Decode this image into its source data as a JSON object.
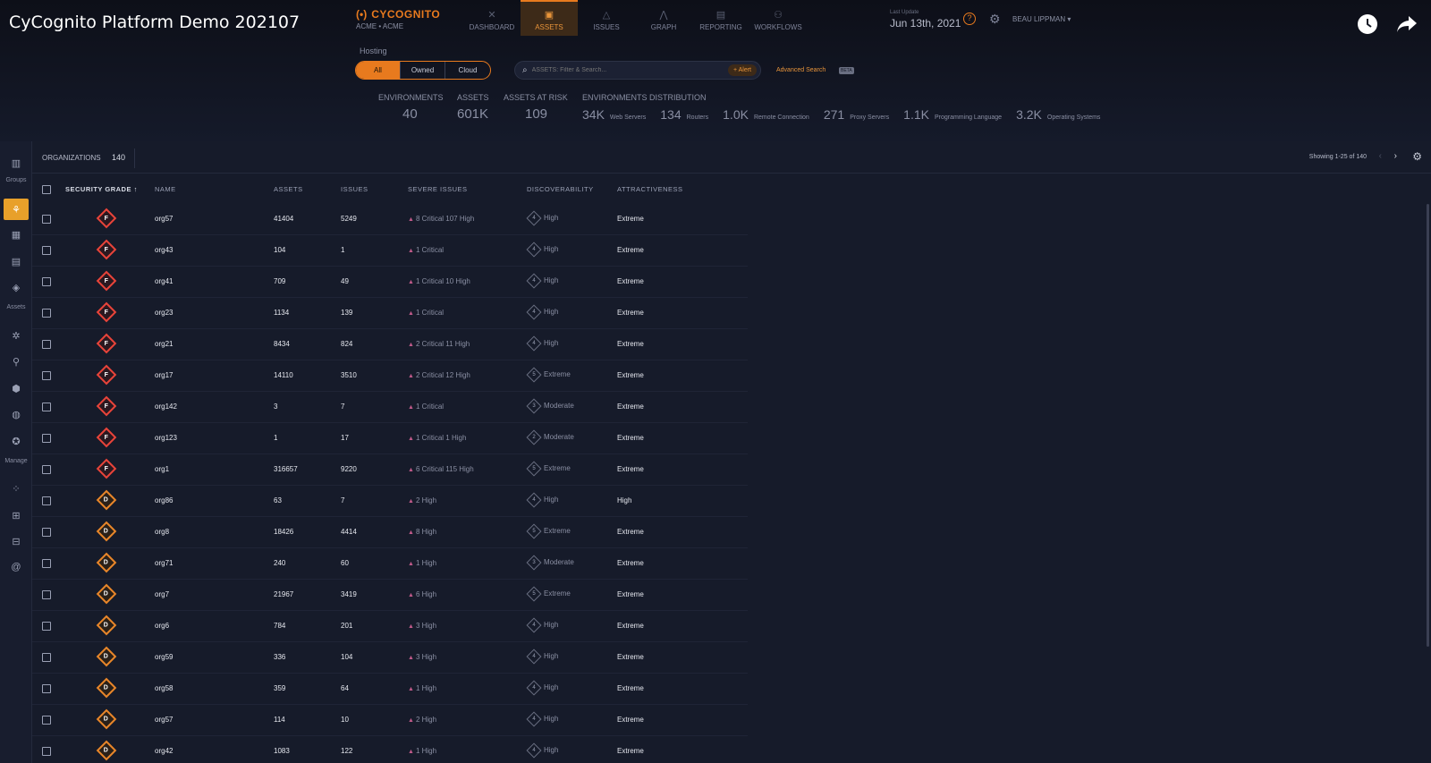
{
  "video": {
    "title": "CyCognito Platform Demo 202107"
  },
  "brand": {
    "name": "CYCOGNITO",
    "org_selector": "ACME • ACME"
  },
  "nav": {
    "items": [
      {
        "label": "DASHBOARD",
        "icon": "close-icon",
        "active": false
      },
      {
        "label": "ASSETS",
        "icon": "assets-icon",
        "active": true
      },
      {
        "label": "ISSUES",
        "icon": "warning-icon",
        "active": false
      },
      {
        "label": "GRAPH",
        "icon": "graph-icon",
        "active": false
      },
      {
        "label": "REPORTING",
        "icon": "report-icon",
        "active": false
      },
      {
        "label": "WORKFLOWS",
        "icon": "workflow-icon",
        "active": false
      }
    ]
  },
  "header_right": {
    "last_update_label": "Last Update",
    "last_update": "Jun 13th, 2021",
    "user": "BEAU LIPPMAN"
  },
  "hosting": {
    "label": "Hosting",
    "options": [
      "All",
      "Owned",
      "Cloud"
    ],
    "selected": "All"
  },
  "search": {
    "placeholder": "ASSETS: Filter & Search...",
    "alert_label": "+ Alert",
    "advanced_label": "Advanced Search",
    "beta": "BETA"
  },
  "stats": {
    "environments": {
      "label": "ENVIRONMENTS",
      "value": "40"
    },
    "assets": {
      "label": "ASSETS",
      "value": "601K"
    },
    "at_risk": {
      "label": "ASSETS AT RISK",
      "value": "109"
    },
    "distribution_label": "ENVIRONMENTS DISTRIBUTION",
    "distribution": [
      {
        "value": "34K",
        "label": "Web Servers"
      },
      {
        "value": "134",
        "label": "Routers"
      },
      {
        "value": "1.0K",
        "label": "Remote Connection"
      },
      {
        "value": "271",
        "label": "Proxy Servers"
      },
      {
        "value": "1.1K",
        "label": "Programming Language"
      },
      {
        "value": "3.2K",
        "label": "Operating Systems"
      }
    ]
  },
  "sidebar": {
    "groups_label": "Groups",
    "assets_label": "Assets",
    "manage_label": "Manage"
  },
  "orgs": {
    "title": "ORGANIZATIONS",
    "count": "140",
    "showing": "Showing 1-25 of 140"
  },
  "table": {
    "headers": {
      "grade": "SECURITY GRADE",
      "sort": "↑",
      "name": "NAME",
      "assets": "ASSETS",
      "issues": "ISSUES",
      "severe": "SEVERE ISSUES",
      "disc": "DISCOVERABILITY",
      "attr": "ATTRACTIVENESS"
    },
    "rows": [
      {
        "grade": "F",
        "name": "org57",
        "assets": "41404",
        "issues": "5249",
        "severe": "8 Critical   107 High",
        "disc_num": "4",
        "disc": "High",
        "attr": "Extreme"
      },
      {
        "grade": "F",
        "name": "org43",
        "assets": "104",
        "issues": "1",
        "severe": "1 Critical",
        "disc_num": "4",
        "disc": "High",
        "attr": "Extreme"
      },
      {
        "grade": "F",
        "name": "org41",
        "assets": "709",
        "issues": "49",
        "severe": "1 Critical   10 High",
        "disc_num": "4",
        "disc": "High",
        "attr": "Extreme"
      },
      {
        "grade": "F",
        "name": "org23",
        "assets": "1134",
        "issues": "139",
        "severe": "1 Critical",
        "disc_num": "4",
        "disc": "High",
        "attr": "Extreme"
      },
      {
        "grade": "F",
        "name": "org21",
        "assets": "8434",
        "issues": "824",
        "severe": "2 Critical   11 High",
        "disc_num": "4",
        "disc": "High",
        "attr": "Extreme"
      },
      {
        "grade": "F",
        "name": "org17",
        "assets": "14110",
        "issues": "3510",
        "severe": "2 Critical   12 High",
        "disc_num": "5",
        "disc": "Extreme",
        "attr": "Extreme"
      },
      {
        "grade": "F",
        "name": "org142",
        "assets": "3",
        "issues": "7",
        "severe": "1 Critical",
        "disc_num": "3",
        "disc": "Moderate",
        "attr": "Extreme"
      },
      {
        "grade": "F",
        "name": "org123",
        "assets": "1",
        "issues": "17",
        "severe": "1 Critical   1 High",
        "disc_num": "2",
        "disc": "Moderate",
        "attr": "Extreme"
      },
      {
        "grade": "F",
        "name": "org1",
        "assets": "316657",
        "issues": "9220",
        "severe": "6 Critical   115 High",
        "disc_num": "5",
        "disc": "Extreme",
        "attr": "Extreme"
      },
      {
        "grade": "D",
        "name": "org86",
        "assets": "63",
        "issues": "7",
        "severe": "2 High",
        "disc_num": "4",
        "disc": "High",
        "attr": "High"
      },
      {
        "grade": "D",
        "name": "org8",
        "assets": "18426",
        "issues": "4414",
        "severe": "8 High",
        "disc_num": "5",
        "disc": "Extreme",
        "attr": "Extreme"
      },
      {
        "grade": "D",
        "name": "org71",
        "assets": "240",
        "issues": "60",
        "severe": "1 High",
        "disc_num": "3",
        "disc": "Moderate",
        "attr": "Extreme"
      },
      {
        "grade": "D",
        "name": "org7",
        "assets": "21967",
        "issues": "3419",
        "severe": "6 High",
        "disc_num": "5",
        "disc": "Extreme",
        "attr": "Extreme"
      },
      {
        "grade": "D",
        "name": "org6",
        "assets": "784",
        "issues": "201",
        "severe": "3 High",
        "disc_num": "4",
        "disc": "High",
        "attr": "Extreme"
      },
      {
        "grade": "D",
        "name": "org59",
        "assets": "336",
        "issues": "104",
        "severe": "3 High",
        "disc_num": "4",
        "disc": "High",
        "attr": "Extreme"
      },
      {
        "grade": "D",
        "name": "org58",
        "assets": "359",
        "issues": "64",
        "severe": "1 High",
        "disc_num": "4",
        "disc": "High",
        "attr": "Extreme"
      },
      {
        "grade": "D",
        "name": "org57",
        "assets": "114",
        "issues": "10",
        "severe": "2 High",
        "disc_num": "4",
        "disc": "High",
        "attr": "Extreme"
      },
      {
        "grade": "D",
        "name": "org42",
        "assets": "1083",
        "issues": "122",
        "severe": "1 High",
        "disc_num": "4",
        "disc": "High",
        "attr": "Extreme"
      }
    ]
  },
  "colors": {
    "accent": "#e87a1e",
    "grade_f": "#e8443a",
    "grade_d": "#e8862a",
    "background": "#141826"
  }
}
